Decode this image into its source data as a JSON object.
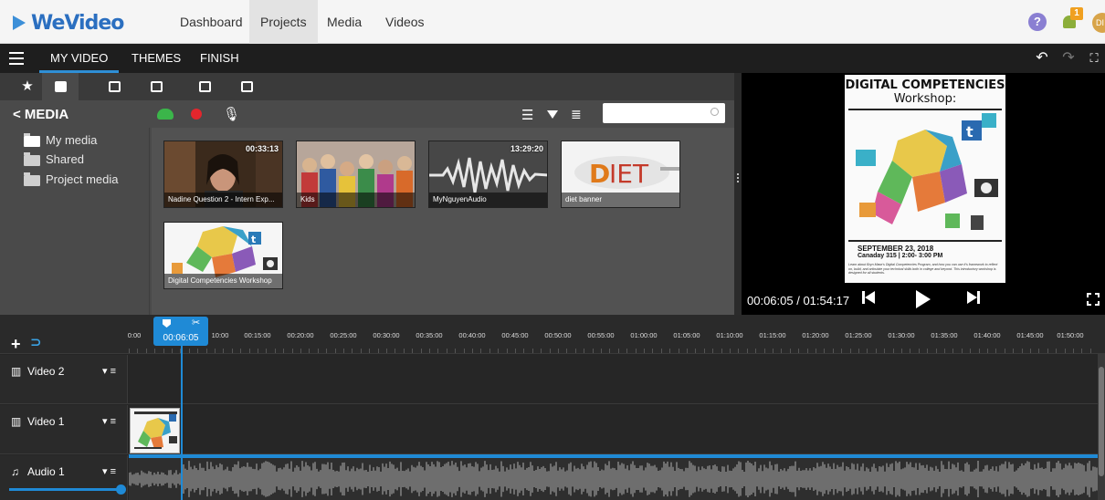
{
  "app": {
    "logo": "WeVideo"
  },
  "nav": {
    "items": [
      "Dashboard",
      "Projects",
      "Media",
      "Videos"
    ],
    "active": "Projects",
    "notifications": "1",
    "help": "?",
    "avatar": "DI"
  },
  "editor_menu": {
    "tabs": [
      "MY VIDEO",
      "THEMES",
      "FINISH"
    ],
    "active": "MY VIDEO"
  },
  "media": {
    "title": "< MEDIA",
    "search_placeholder": "",
    "folders": [
      "My media",
      "Shared",
      "Project media"
    ],
    "items": [
      {
        "label": "Nadine Question 2 - Intern Exp...",
        "duration": "00:33:13"
      },
      {
        "label": "Kids",
        "duration": ""
      },
      {
        "label": "MyNguyenAudio",
        "duration": "13:29:20"
      },
      {
        "label": "diet banner",
        "duration": ""
      },
      {
        "label": "Digital Competencies Workshop",
        "duration": ""
      }
    ]
  },
  "preview": {
    "timecode": "00:06:05 / 01:54:17",
    "poster": {
      "headline": "DIGITAL COMPETENCIES",
      "subhead": "Workshop:",
      "date": "SEPTEMBER 23, 2018",
      "location": "Canaday 315 | 2:00- 3:00 PM",
      "description": "Learn about Bryn Mawr's Digital Competencies Program, and how you can use it's framework to reflect on, build, and articulate your technical skills both in college and beyond. This introductory workshop is designed for all students."
    }
  },
  "timeline": {
    "playhead": "00:06:05",
    "ticks": [
      "0:00",
      "10:00",
      "00:15:00",
      "00:20:00",
      "00:25:00",
      "00:30:00",
      "00:35:00",
      "00:40:00",
      "00:45:00",
      "00:50:00",
      "00:55:00",
      "01:00:00",
      "01:05:00",
      "01:10:00",
      "01:15:00",
      "01:20:00",
      "01:25:00",
      "01:30:00",
      "01:35:00",
      "01:40:00",
      "01:45:00",
      "01:50:00"
    ],
    "tracks": [
      "Video 2",
      "Video 1",
      "Audio 1"
    ]
  },
  "colors": {
    "accent": "#1f8ad6",
    "record": "#e3262d",
    "upload": "#3bb54a"
  }
}
